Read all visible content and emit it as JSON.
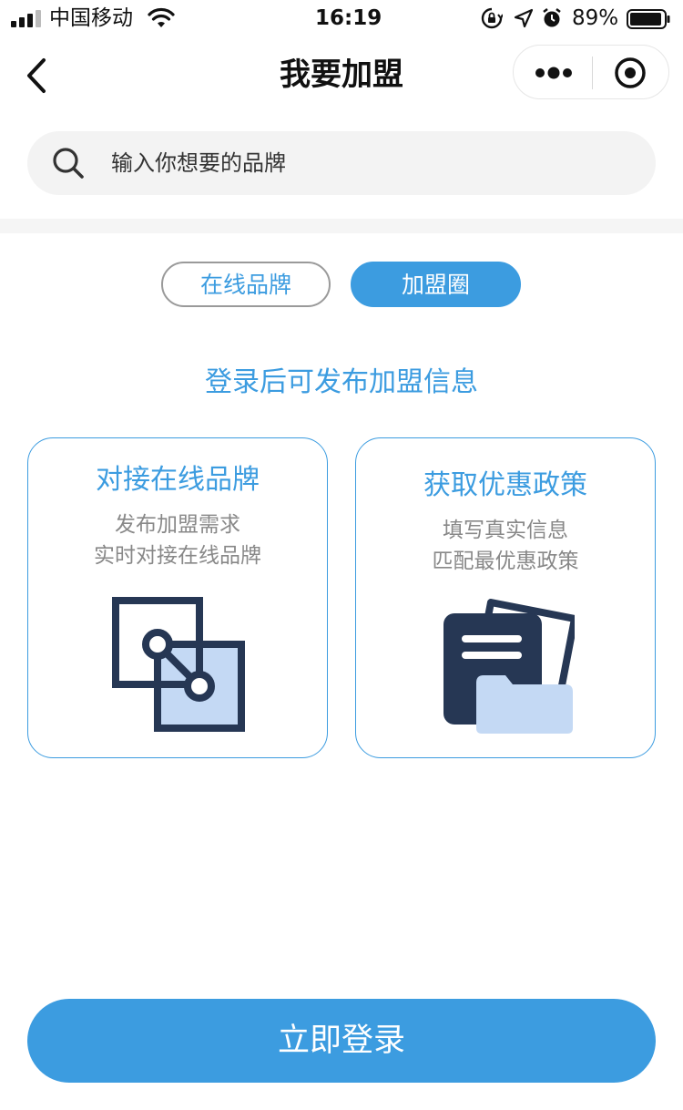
{
  "status_bar": {
    "carrier": "中国移动",
    "time": "16:19",
    "battery_percent": "89%",
    "icons": [
      "signal-icon",
      "wifi-icon",
      "orientation-lock-icon",
      "location-icon",
      "alarm-icon",
      "battery-icon"
    ]
  },
  "nav": {
    "title": "我要加盟",
    "back_icon": "chevron-left-icon",
    "more_icon": "more-dots-icon",
    "close_icon": "target-close-icon"
  },
  "search": {
    "placeholder": "输入你想要的品牌",
    "icon": "search-icon"
  },
  "tabs": [
    {
      "label": "在线品牌",
      "active": false
    },
    {
      "label": "加盟圈",
      "active": true
    }
  ],
  "login_hint": "登录后可发布加盟信息",
  "cards": [
    {
      "title": "对接在线品牌",
      "desc_lines": [
        "发布加盟需求",
        "实时对接在线品牌"
      ],
      "icon": "connect-squares-icon"
    },
    {
      "title": "获取优惠政策",
      "desc_lines": [
        "填写真实信息",
        "匹配最优惠政策"
      ],
      "icon": "document-folder-icon"
    }
  ],
  "login_button": "立即登录",
  "colors": {
    "accent": "#3c9ce0",
    "illustration_dark": "#263754",
    "illustration_light": "#c4d9f4",
    "muted_text": "#888888"
  }
}
